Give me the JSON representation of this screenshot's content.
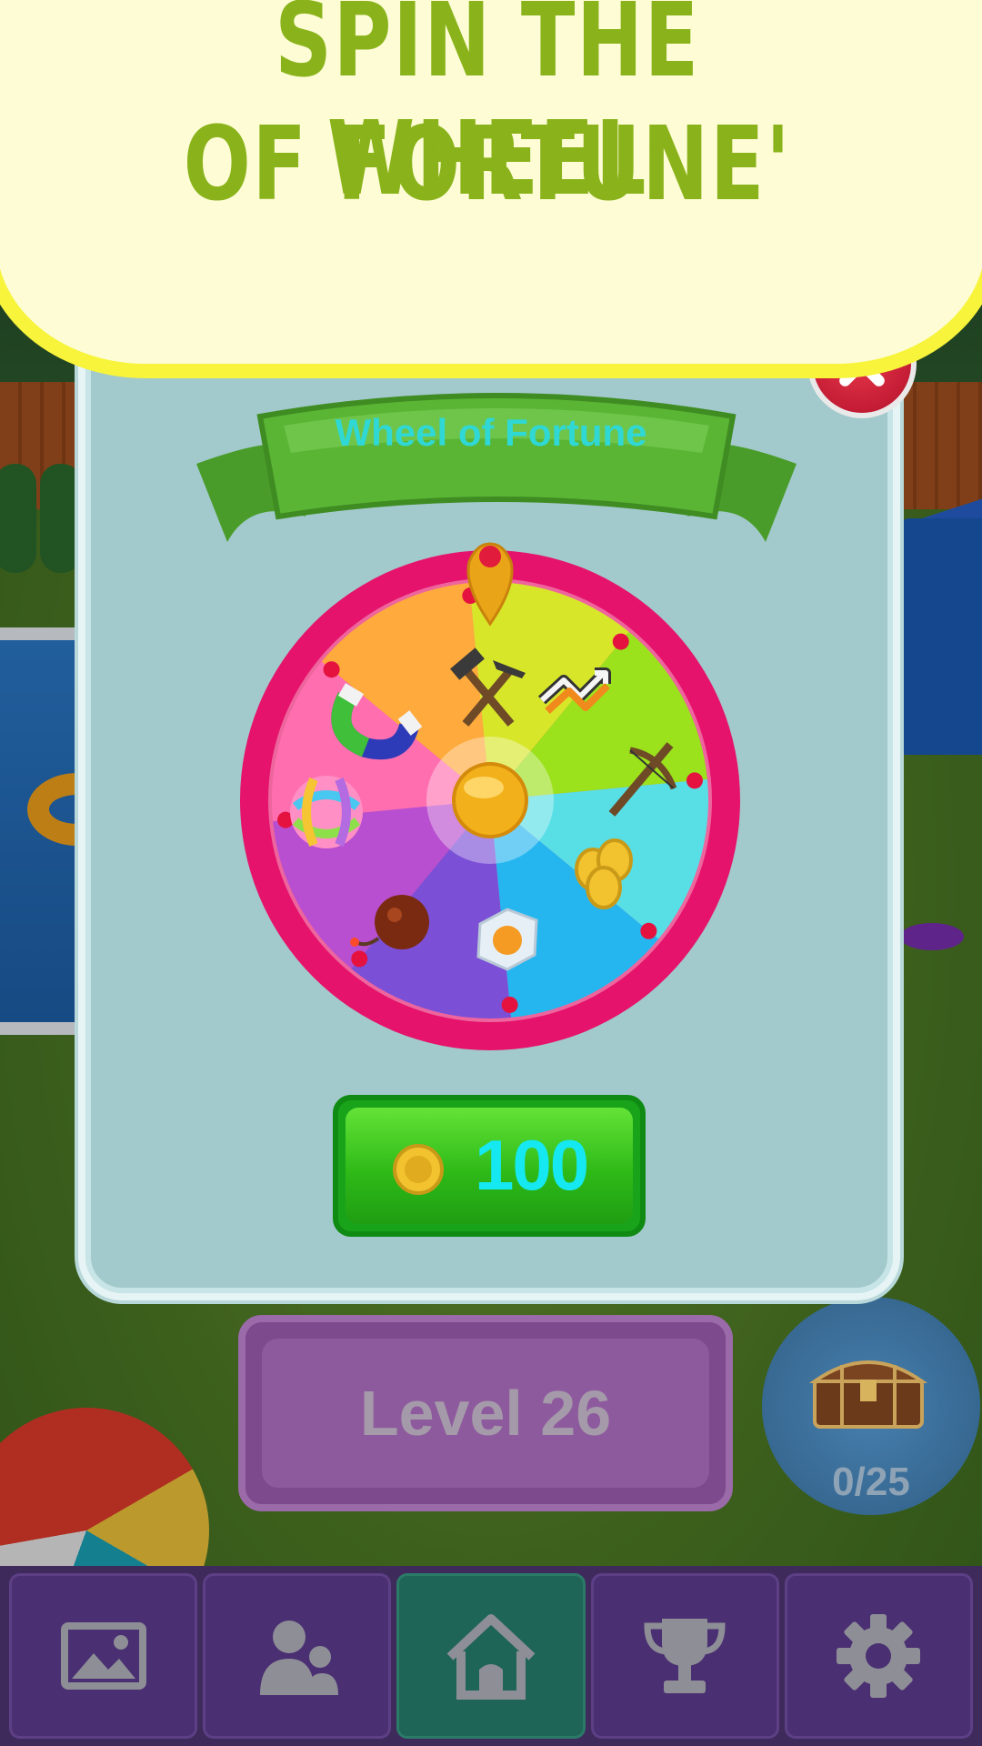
{
  "banner": {
    "line1": "SPIN THE WHEEL",
    "line2": "OF FORTUNE'"
  },
  "dialog": {
    "title": "Wheel of Fortune",
    "close_icon": "close-icon",
    "spin_price": "100",
    "coin_icon": "coin-icon"
  },
  "wheel": {
    "segments": [
      {
        "item": "hammer-pick-icon",
        "color": "#d8e62a"
      },
      {
        "item": "swap-arrows-icon",
        "color": "#9be11c"
      },
      {
        "item": "crossbow-icon",
        "color": "#58dfe6"
      },
      {
        "item": "coins-icon",
        "color": "#25b6f0"
      },
      {
        "item": "ice-block-icon",
        "color": "#7b4fd6"
      },
      {
        "item": "bomb-icon",
        "color": "#b84fd0"
      },
      {
        "item": "yarn-ball-icon",
        "color": "#ff6fb0"
      },
      {
        "item": "magnet-icon",
        "color": "#ffaa3c"
      }
    ],
    "rim_color": "#e5136b"
  },
  "level": {
    "label": "Level 26"
  },
  "chest": {
    "icon": "treasure-chest-icon",
    "count": "0/25"
  },
  "nav": {
    "items": [
      {
        "icon": "image-icon",
        "active": false
      },
      {
        "icon": "friends-icon",
        "active": false
      },
      {
        "icon": "home-icon",
        "active": true
      },
      {
        "icon": "trophy-icon",
        "active": false
      },
      {
        "icon": "gear-icon",
        "active": false
      }
    ]
  }
}
